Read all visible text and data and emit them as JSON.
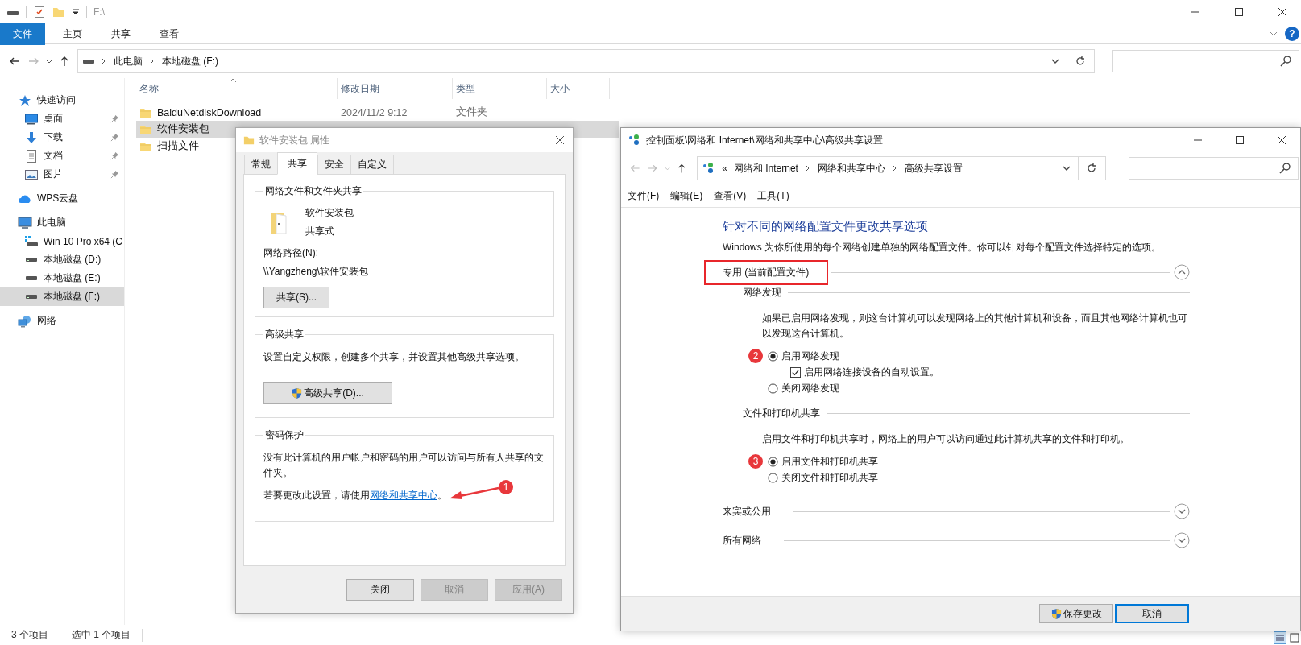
{
  "explorer": {
    "title": "F:\\",
    "ribbon_tabs": [
      {
        "label": "文件",
        "selected": true
      },
      {
        "label": "主页",
        "selected": false
      },
      {
        "label": "共享",
        "selected": false
      },
      {
        "label": "查看",
        "selected": false
      }
    ],
    "help": "?",
    "address": [
      "此电脑",
      "本地磁盘 (F:)"
    ],
    "sidebar": [
      {
        "label": "快速访问",
        "kind": "quick_access",
        "selected": false,
        "children": [
          {
            "label": "桌面",
            "kind": "desktop",
            "pinned": true,
            "selected": false
          },
          {
            "label": "下载",
            "kind": "downloads",
            "pinned": true,
            "selected": false
          },
          {
            "label": "文档",
            "kind": "documents",
            "pinned": true,
            "selected": false
          },
          {
            "label": "图片",
            "kind": "pictures",
            "pinned": true,
            "selected": false
          }
        ]
      },
      {
        "label": "WPS云盘",
        "kind": "cloud",
        "selected": false
      },
      {
        "label": "此电脑",
        "kind": "computer",
        "selected": false,
        "children": [
          {
            "label": "Win 10 Pro x64 (C",
            "kind": "system_drive",
            "selected": false
          },
          {
            "label": "本地磁盘 (D:)",
            "kind": "drive",
            "selected": false
          },
          {
            "label": "本地磁盘 (E:)",
            "kind": "drive",
            "selected": false
          },
          {
            "label": "本地磁盘 (F:)",
            "kind": "drive",
            "selected": true
          }
        ]
      },
      {
        "label": "网络",
        "kind": "network",
        "selected": false
      }
    ],
    "columns": [
      "名称",
      "修改日期",
      "类型",
      "大小"
    ],
    "rows": [
      {
        "name": "BaiduNetdiskDownload",
        "modified": "2024/11/2 9:12",
        "type": "文件夹",
        "selected": false
      },
      {
        "name": "软件安装包",
        "selected": true
      },
      {
        "name": "扫描文件",
        "selected": false
      }
    ],
    "status_bar": [
      "3 个项目",
      "选中 1 个项目"
    ]
  },
  "properties_dialog": {
    "title": "软件安装包 属性",
    "tabs": [
      {
        "label": "常规",
        "selected": false
      },
      {
        "label": "共享",
        "selected": true
      },
      {
        "label": "安全",
        "selected": false
      },
      {
        "label": "自定义",
        "selected": false
      }
    ],
    "network_sharing": {
      "title": "网络文件和文件夹共享",
      "folder_name": "软件安装包",
      "share_state": "共享式",
      "path_label": "网络路径(N):",
      "path": "\\\\Yangzheng\\软件安装包",
      "button": "共享(S)..."
    },
    "advanced_sharing": {
      "title": "高级共享",
      "description": "设置自定义权限，创建多个共享，并设置其他高级共享选项。",
      "button": "高级共享(D)..."
    },
    "password_protection": {
      "title": "密码保护",
      "description": "没有此计算机的用户帐户和密码的用户可以访问与所有人共享的文件夹。",
      "change_text": "若要更改此设置，请使用",
      "link": "网络和共享中心",
      "change_text_end": "。",
      "annotation_marker": "1"
    },
    "buttons": [
      {
        "label": "关闭",
        "disabled": false
      },
      {
        "label": "取消",
        "disabled": true
      },
      {
        "label": "应用(A)",
        "disabled": true
      }
    ]
  },
  "sharing_window": {
    "title": "控制面板\\网络和 Internet\\网络和共享中心\\高级共享设置",
    "address_overflow": "«",
    "address": [
      "网络和 Internet",
      "网络和共享中心",
      "高级共享设置"
    ],
    "menu": [
      "文件(F)",
      "编辑(E)",
      "查看(V)",
      "工具(T)"
    ],
    "heading": "针对不同的网络配置文件更改共享选项",
    "description": "Windows 为你所使用的每个网络创建单独的网络配置文件。你可以针对每个配置文件选择特定的选项。",
    "profiles": [
      {
        "title": "专用 (当前配置文件)",
        "expanded": true,
        "highlighted": true,
        "sections": [
          {
            "title": "网络发现",
            "description": "如果已启用网络发现，则这台计算机可以发现网络上的其他计算机和设备，而且其他网络计算机也可以发现这台计算机。",
            "options": [
              {
                "kind": "radio",
                "label": "启用网络发现",
                "checked": true,
                "marker": "2"
              },
              {
                "kind": "checkbox",
                "label": "启用网络连接设备的自动设置。",
                "checked": true
              },
              {
                "kind": "radio",
                "label": "关闭网络发现",
                "checked": false
              }
            ]
          },
          {
            "title": "文件和打印机共享",
            "description": "启用文件和打印机共享时，网络上的用户可以访问通过此计算机共享的文件和打印机。",
            "options": [
              {
                "kind": "radio",
                "label": "启用文件和打印机共享",
                "checked": true,
                "marker": "3"
              },
              {
                "kind": "radio",
                "label": "关闭文件和打印机共享",
                "checked": false
              }
            ]
          }
        ]
      },
      {
        "title": "来宾或公用",
        "expanded": false,
        "highlighted": false
      },
      {
        "title": "所有网络",
        "expanded": false,
        "highlighted": false
      }
    ],
    "buttons": [
      {
        "label": "保存更改",
        "kind": "elevated",
        "default": false
      },
      {
        "label": "取消",
        "kind": "plain",
        "default": true
      }
    ]
  }
}
